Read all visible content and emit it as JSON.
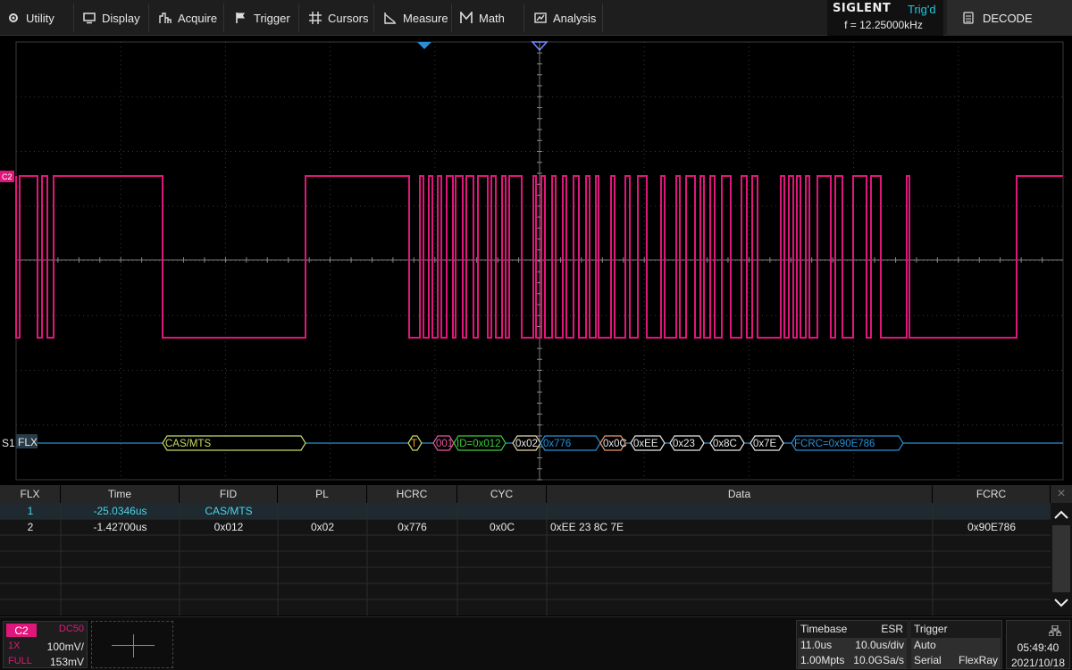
{
  "menu": {
    "utility": "Utility",
    "display": "Display",
    "acquire": "Acquire",
    "trigger": "Trigger",
    "cursors": "Cursors",
    "measure": "Measure",
    "math": "Math",
    "analysis": "Analysis"
  },
  "brand": {
    "logo": "SIGLENT",
    "status": "Trig'd",
    "frequency": "f = 12.25000kHz"
  },
  "decode_button": "DECODE",
  "channel_marker": "C2",
  "bus": {
    "source": "S1",
    "protocol": "FLX",
    "frames": [
      "CAS/MTS",
      "T",
      "001",
      "ID=0x012",
      "0x02",
      "0x776",
      "0x0C",
      "0xEE",
      "0x23",
      "0x8C",
      "0x7E",
      "FCRC=0x90E786"
    ]
  },
  "table": {
    "headers": [
      "FLX",
      "Time",
      "FID",
      "PL",
      "HCRC",
      "CYC",
      "Data",
      "FCRC"
    ],
    "rows": [
      [
        "1",
        "-25.0346us",
        "CAS/MTS",
        "",
        "",
        "",
        "",
        ""
      ],
      [
        "2",
        "-1.42700us",
        "0x012",
        "0x02",
        "0x776",
        "0x0C",
        "0xEE 23 8C 7E",
        "0x90E786"
      ]
    ],
    "close": "×"
  },
  "channel": {
    "label": "C2",
    "coupling": "DC50",
    "probe": "1X",
    "vdiv": "100mV/",
    "bandwidth": "FULL",
    "offset": "153mV"
  },
  "timebase": {
    "title": "Timebase",
    "mode": "ESR",
    "delay": "11.0us",
    "tdiv": "10.0us/div",
    "mem": "1.00Mpts",
    "rate": "10.0GSa/s"
  },
  "trigger": {
    "title": "Trigger",
    "mode": "Auto",
    "type": "Serial",
    "source": "FlexRay"
  },
  "clock": {
    "time": "05:49:40",
    "date": "2021/10/18"
  },
  "colors": {
    "ch2": "#e0177a",
    "bus": "#2a8fd6",
    "accent": "#1fc7e0"
  }
}
